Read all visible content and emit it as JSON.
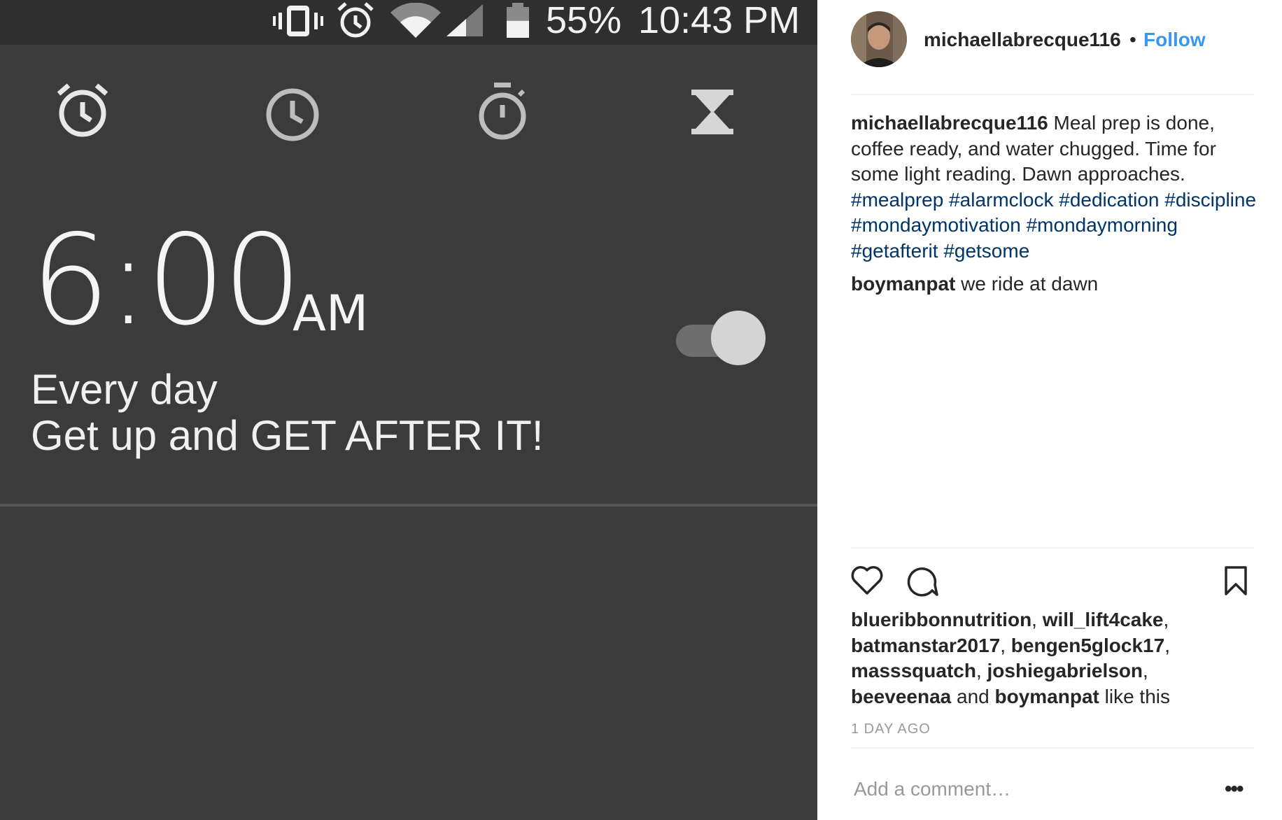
{
  "photo": {
    "status_bar": {
      "battery_percent": "55%",
      "time": "10:43 PM",
      "icons": [
        "vibrate-icon",
        "alarm-status-icon",
        "wifi-icon",
        "signal-icon",
        "battery-icon"
      ],
      "battery_level": 0.55
    },
    "tabs": [
      {
        "icon": "alarm-tab-icon"
      },
      {
        "icon": "clock-tab-icon"
      },
      {
        "icon": "stopwatch-tab-icon"
      },
      {
        "icon": "timer-tab-icon"
      }
    ],
    "alarm": {
      "time": "6:00",
      "ampm": "AM",
      "repeat": "Every day",
      "label": "Get up and GET AFTER IT!",
      "enabled": true
    },
    "colors": {
      "background": "#3b3b3b",
      "status_bar": "#2f2f2f",
      "text": "#f5f5f5"
    }
  },
  "post": {
    "author": "michaellabrecque116",
    "separator": "•",
    "follow_label": "Follow",
    "caption": {
      "username": "michaellabrecque116",
      "text": " Meal prep is done, coffee ready, and water chugged. Time for some light reading. Dawn approaches. ",
      "hashtags": [
        "#mealprep",
        "#alarmclock",
        "#dedication",
        "#discipline",
        "#mondaymotivation",
        "#mondaymorning",
        "#getafterit",
        "#getsome"
      ]
    },
    "comments": [
      {
        "username": "boymanpat",
        "text": " we ride at dawn"
      }
    ],
    "actions": [
      "heart-icon",
      "comment-icon",
      "bookmark-icon"
    ],
    "likes": {
      "users": [
        "blueribbonnutrition",
        "will_lift4cake",
        "batmanstar2017",
        "bengen5glock17",
        "masssquatch",
        "joshiegabrielson",
        "beeveenaa"
      ],
      "and_text": " and ",
      "last_user": "boymanpat",
      "suffix": " like this"
    },
    "time_ago": "1 DAY AGO",
    "comment_placeholder": "Add a comment…",
    "more_label": "•••",
    "colors": {
      "link": "#3897f0",
      "hashtag": "#003569",
      "text": "#262626",
      "muted": "#999999"
    }
  }
}
